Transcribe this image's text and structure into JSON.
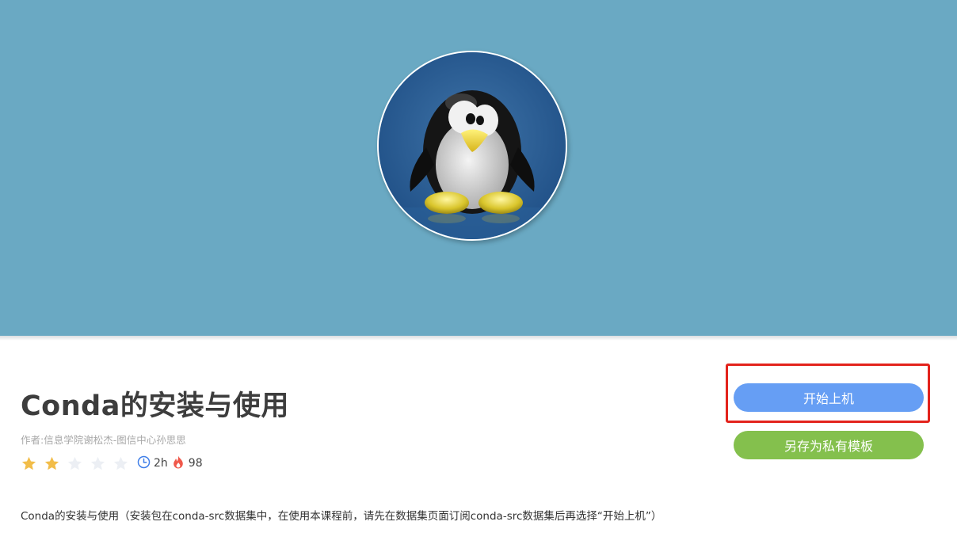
{
  "banner": {
    "background_color": "#6aa9c3",
    "avatar_icon": "linux-tux-penguin-icon"
  },
  "course": {
    "title": "Conda的安装与使用",
    "author": "作者:信息学院谢松杰-图信中心孙思思",
    "rating": 2,
    "rating_max": 5,
    "duration": "2h",
    "popularity": "98",
    "description": "Conda的安装与使用（安装包在conda-src数据集中，在使用本课程前，请先在数据集页面订阅conda-src数据集后再选择“开始上机”）"
  },
  "actions": {
    "start_label": "开始上机",
    "save_template_label": "另存为私有模板",
    "start_color": "#669ef4",
    "save_color": "#84c04d",
    "highlight_color": "#e3231c"
  },
  "icons": {
    "star_filled_color": "#f2bd49",
    "star_empty_color": "#eceff4",
    "clock_icon": "clock-icon",
    "flame_icon": "flame-icon"
  }
}
